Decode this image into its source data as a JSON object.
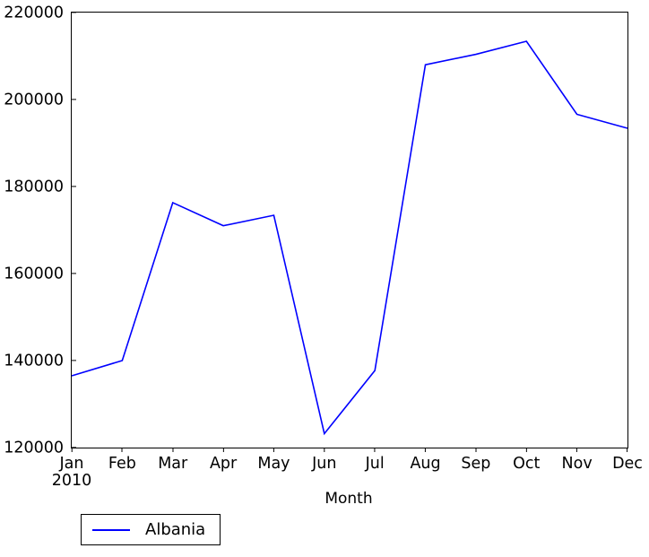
{
  "chart_data": {
    "type": "line",
    "title": "",
    "xlabel": "Month",
    "ylabel": "",
    "x": [
      "Jan",
      "Feb",
      "Mar",
      "Apr",
      "May",
      "Jun",
      "Jul",
      "Aug",
      "Sep",
      "Oct",
      "Nov",
      "Dec"
    ],
    "x_sublabels": [
      "2010",
      "",
      "",
      "",
      "",
      "",
      "",
      "",
      "",
      "",
      "",
      ""
    ],
    "categories": [
      "Jan",
      "Feb",
      "Mar",
      "Apr",
      "May",
      "Jun",
      "Jul",
      "Aug",
      "Sep",
      "Oct",
      "Nov",
      "Dec"
    ],
    "series": [
      {
        "name": "Albania",
        "color": "#0000ff",
        "values": [
          136500,
          140000,
          176300,
          171000,
          173400,
          123200,
          137700,
          208000,
          210400,
          213400,
          196600,
          193400
        ]
      }
    ],
    "xlim": [
      0,
      11
    ],
    "ylim": [
      120000,
      220000
    ],
    "yticks": [
      120000,
      140000,
      160000,
      180000,
      200000,
      220000
    ],
    "ytick_labels": [
      "120000",
      "140000",
      "160000",
      "180000",
      "200000",
      "220000"
    ],
    "grid": false,
    "legend_position": "lower left outside",
    "legend_entries": [
      "Albania"
    ],
    "line_color": "#0000ff",
    "axis_color": "#000000",
    "background_color": "#ffffff"
  }
}
